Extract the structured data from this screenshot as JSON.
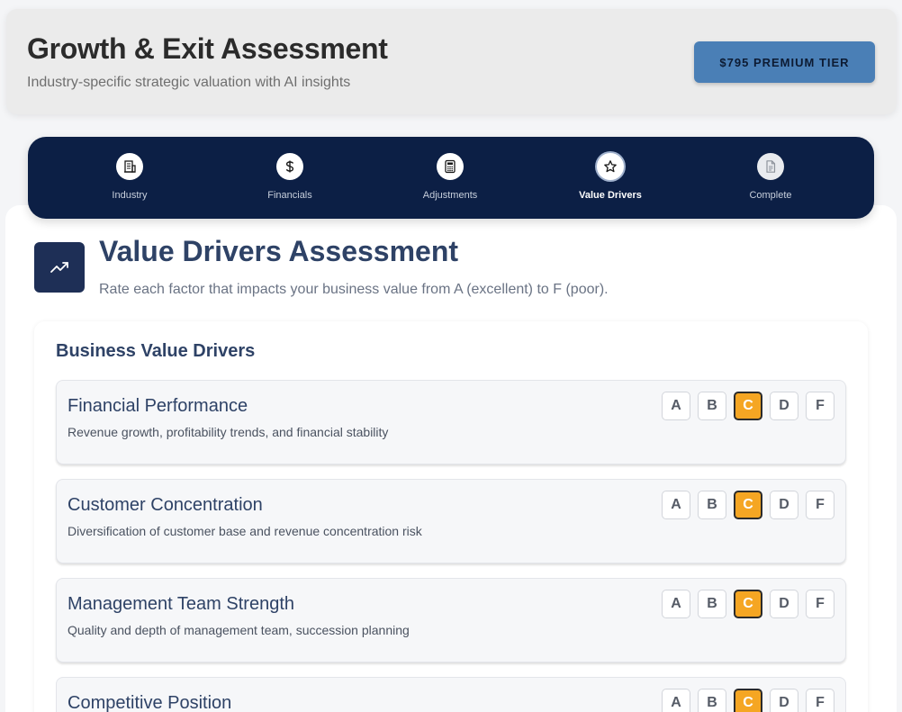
{
  "header": {
    "title": "Growth & Exit Assessment",
    "subtitle": "Industry-specific strategic valuation with AI insights",
    "tier_button": "$795 PREMIUM TIER"
  },
  "stepper": {
    "steps": [
      {
        "label": "Industry",
        "icon": "building-icon"
      },
      {
        "label": "Financials",
        "icon": "dollar-icon"
      },
      {
        "label": "Adjustments",
        "icon": "calculator-icon"
      },
      {
        "label": "Value Drivers",
        "icon": "star-icon"
      },
      {
        "label": "Complete",
        "icon": "document-icon"
      }
    ],
    "active_step": "Value Drivers"
  },
  "section": {
    "icon": "trending-up-icon",
    "title": "Value Drivers Assessment",
    "description": "Rate each factor that impacts your business value from A (excellent) to F (poor)."
  },
  "drivers": {
    "heading": "Business Value Drivers",
    "grade_options": [
      "A",
      "B",
      "C",
      "D",
      "F"
    ],
    "items": [
      {
        "title": "Financial Performance",
        "description": "Revenue growth, profitability trends, and financial stability",
        "selected": "C"
      },
      {
        "title": "Customer Concentration",
        "description": "Diversification of customer base and revenue concentration risk",
        "selected": "C"
      },
      {
        "title": "Management Team Strength",
        "description": "Quality and depth of management team, succession planning",
        "selected": "C"
      },
      {
        "title": "Competitive Position",
        "description": "",
        "selected": "C"
      }
    ]
  },
  "colors": {
    "stepper_bg": "#0c1f45",
    "tier_button": "#4a7fb6",
    "selected_grade": "#f5a623",
    "title_text": "#2e4266"
  }
}
